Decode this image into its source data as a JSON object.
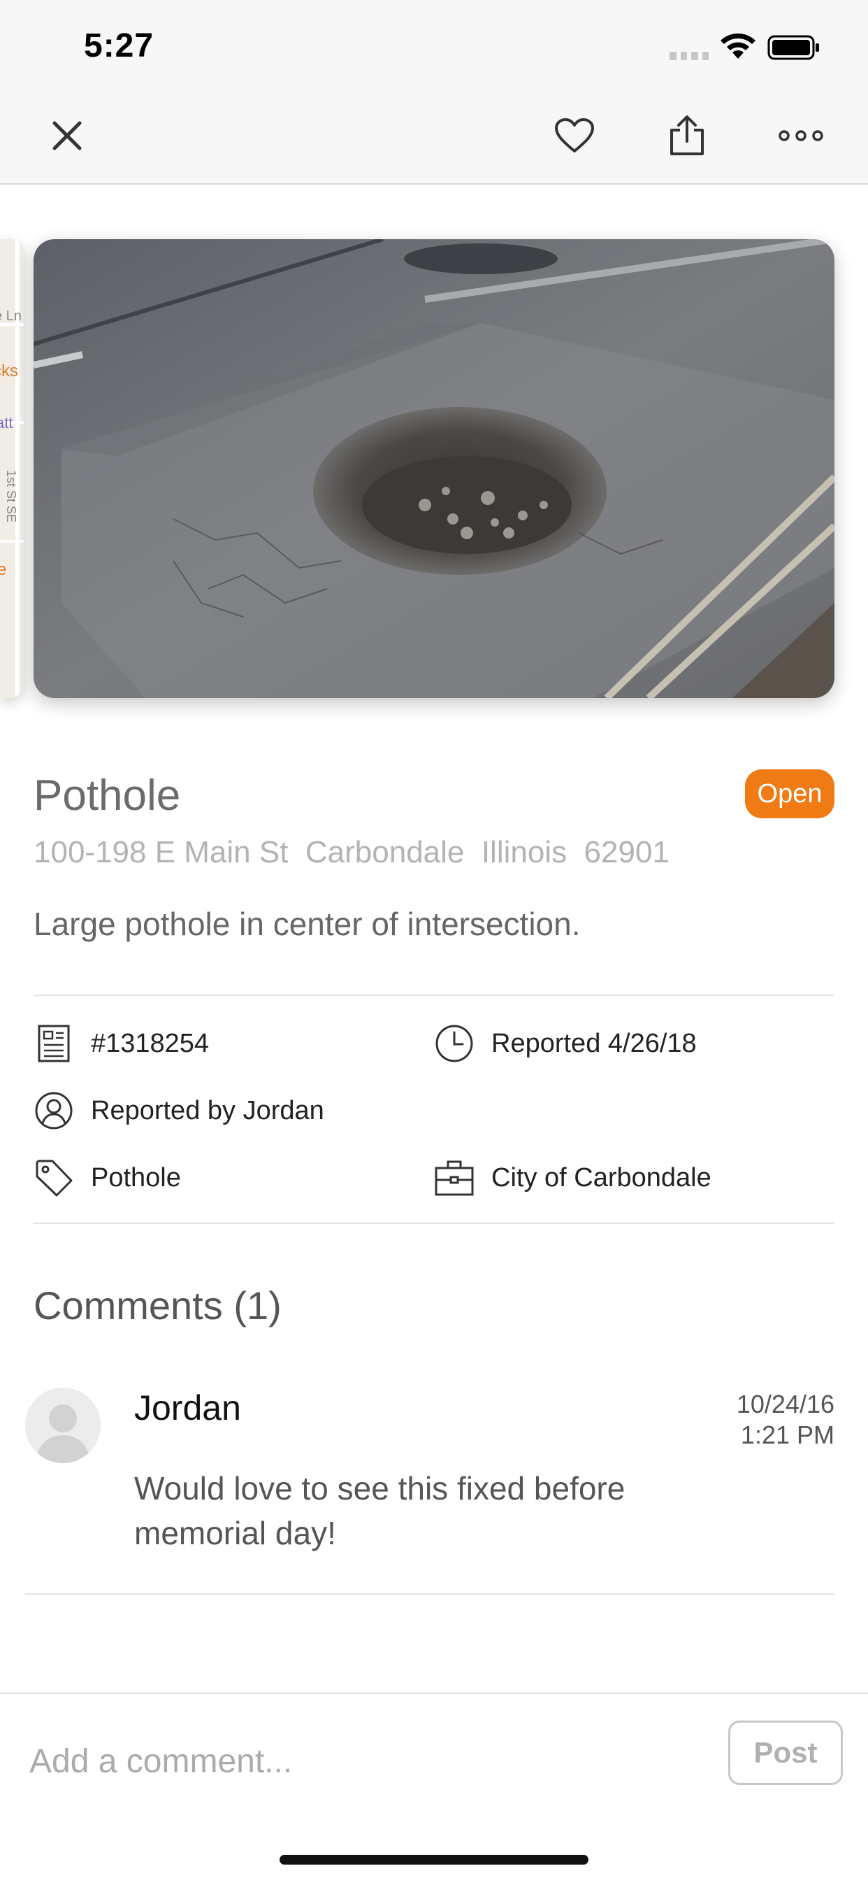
{
  "status_bar": {
    "time": "5:27"
  },
  "nav": {
    "close_icon": "close-x",
    "favorite_icon": "heart-outline",
    "share_icon": "share-up-arrow",
    "more_icon": "ellipsis-horizontal"
  },
  "map_peek_labels": [
    "e Ln",
    "cks",
    "att",
    "1st St SE",
    "e"
  ],
  "issue": {
    "title": "Pothole",
    "status": "Open",
    "address": "100-198 E Main St  Carbondale  Illinois  62901",
    "description": "Large pothole in center of intersection."
  },
  "details": {
    "id": "#1318254",
    "reported": "Reported 4/26/18",
    "reported_by": "Reported by Jordan",
    "category": "Pothole",
    "department": "City of Carbondale"
  },
  "comments": {
    "heading": "Comments (1)",
    "items": [
      {
        "author": "Jordan",
        "date": "10/24/16",
        "time": "1:21 PM",
        "text": "Would love to see this fixed before memorial day!"
      }
    ]
  },
  "composer": {
    "placeholder": "Add a comment...",
    "post_label": "Post"
  },
  "colors": {
    "accent_open": "#f07a14",
    "title_gray": "#6b6b6b",
    "address_gray": "#b3b3b3"
  }
}
